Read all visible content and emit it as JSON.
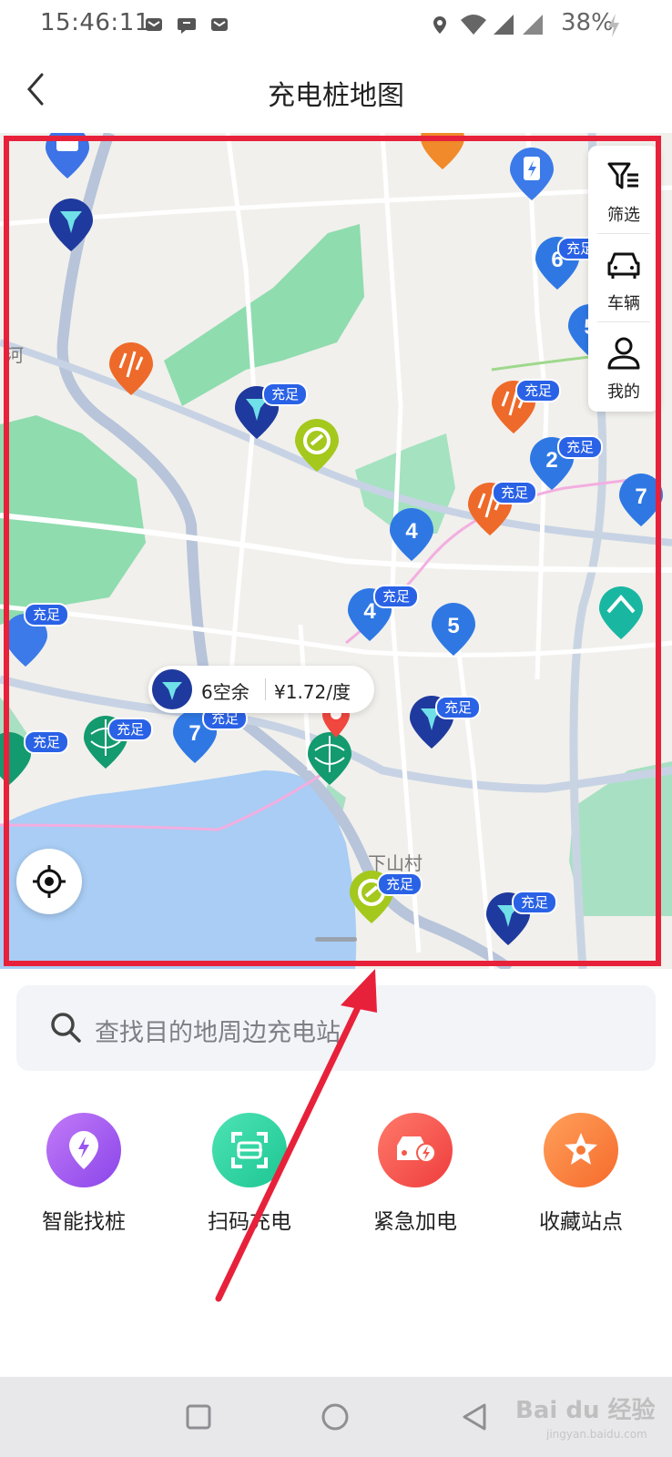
{
  "status_bar": {
    "time": "15:46:11",
    "battery": "38%",
    "icons": [
      "mail-icon",
      "message-icon",
      "mail-icon",
      "location-icon",
      "wifi-icon",
      "signal-icon",
      "signal-icon",
      "charging-icon"
    ]
  },
  "header": {
    "title": "充电桩地图",
    "back_icon": "chevron-left-icon"
  },
  "map": {
    "labels": [
      "河",
      "下山村"
    ],
    "badge_text": "充足",
    "cluster_counts": [
      "6",
      "5",
      "2",
      "7",
      "4",
      "4",
      "5",
      "7"
    ],
    "info_bubble": {
      "availability": "6空余",
      "price": "¥1.72/度"
    },
    "toolbar": [
      {
        "label": "筛选",
        "icon": "filter-icon"
      },
      {
        "label": "车辆",
        "icon": "car-icon"
      },
      {
        "label": "我的",
        "icon": "user-icon"
      }
    ],
    "locate_icon": "locate-icon"
  },
  "search": {
    "placeholder": "查找目的地周边充电站"
  },
  "actions": [
    {
      "label": "智能找桩",
      "icon": "smart-find-icon",
      "color": "#a05cf0"
    },
    {
      "label": "扫码充电",
      "icon": "scan-icon",
      "color": "#2fd3a0"
    },
    {
      "label": "紧急加电",
      "icon": "emergency-car-icon",
      "color": "#f5524a"
    },
    {
      "label": "收藏站点",
      "icon": "star-icon",
      "color": "#f97b3a"
    }
  ],
  "navbar": {
    "icons": [
      "recent-apps-icon",
      "home-icon",
      "back-icon"
    ]
  },
  "watermark": {
    "brand": "Bai du 经验",
    "url": "jingyan.baidu.com"
  },
  "colors": {
    "highlight_frame": "#e8213b",
    "badge": "#2a62e6",
    "water": "#a9cdf4",
    "park": "#8fdcaf"
  }
}
